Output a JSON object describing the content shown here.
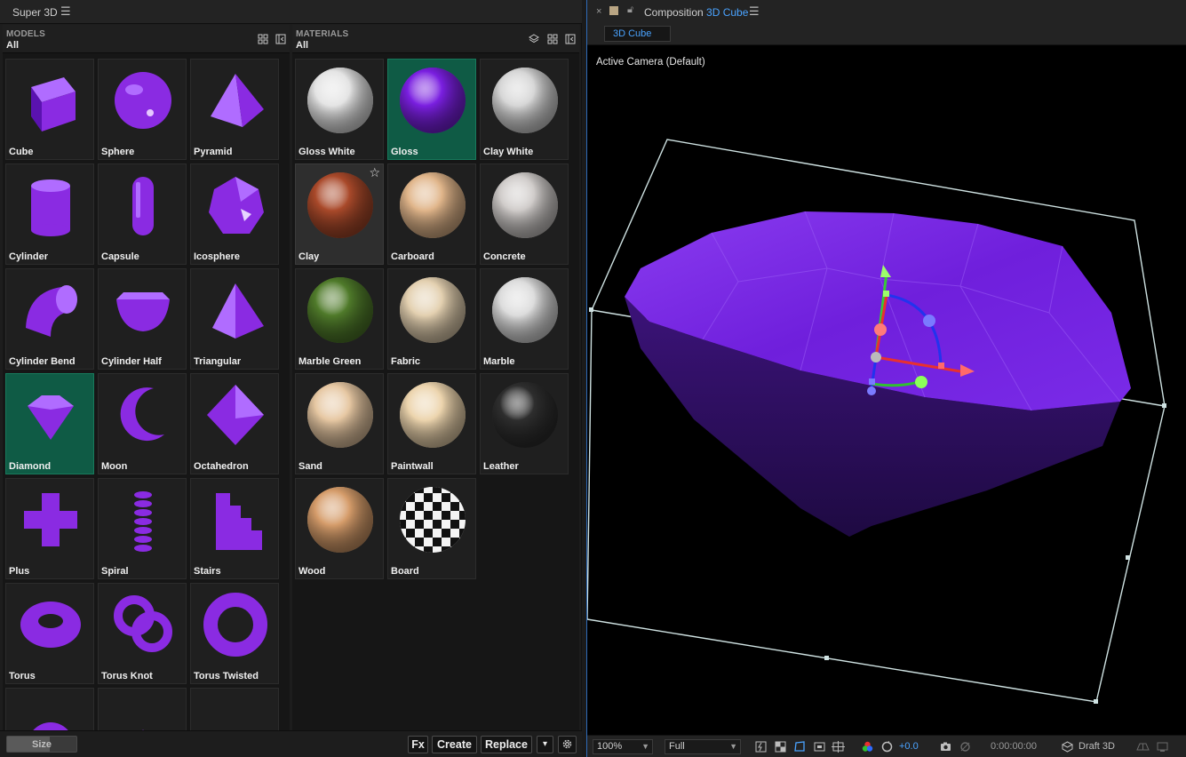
{
  "panel": {
    "title": "Super 3D",
    "menu_icon": "hamburger-icon"
  },
  "models": {
    "header_label": "MODELS",
    "header_sub": "All",
    "items": [
      {
        "label": "Cube",
        "shape": "cube"
      },
      {
        "label": "Sphere",
        "shape": "sphere"
      },
      {
        "label": "Pyramid",
        "shape": "pyramid"
      },
      {
        "label": "Cylinder",
        "shape": "cylinder"
      },
      {
        "label": "Capsule",
        "shape": "capsule"
      },
      {
        "label": "Icosphere",
        "shape": "icosphere"
      },
      {
        "label": "Cylinder Bend",
        "shape": "bend"
      },
      {
        "label": "Cylinder Half",
        "shape": "half"
      },
      {
        "label": "Triangular",
        "shape": "triangular"
      },
      {
        "label": "Diamond",
        "shape": "diamond",
        "selected": true
      },
      {
        "label": "Moon",
        "shape": "moon"
      },
      {
        "label": "Octahedron",
        "shape": "octahedron"
      },
      {
        "label": "Plus",
        "shape": "plus"
      },
      {
        "label": "Spiral",
        "shape": "spiral"
      },
      {
        "label": "Stairs",
        "shape": "stairs"
      },
      {
        "label": "Torus",
        "shape": "torus"
      },
      {
        "label": "Torus Knot",
        "shape": "knot"
      },
      {
        "label": "Torus Twisted",
        "shape": "twisted"
      },
      {
        "label": "",
        "shape": "gear"
      },
      {
        "label": "",
        "shape": "pyramid-small"
      },
      {
        "label": "",
        "shape": "star"
      }
    ]
  },
  "materials": {
    "header_label": "MATERIALS",
    "header_sub": "All",
    "items": [
      {
        "label": "Gloss White",
        "color": "#e4e4e4"
      },
      {
        "label": "Gloss",
        "color": "#7a1fe0",
        "selected": true
      },
      {
        "label": "Clay White",
        "color": "#d6d6d6"
      },
      {
        "label": "Clay",
        "color": "#a9492a",
        "hovered": true,
        "star": "☆"
      },
      {
        "label": "Carboard",
        "color": "#e0b58a"
      },
      {
        "label": "Concrete",
        "color": "#cfcbc9"
      },
      {
        "label": "Marble Green",
        "color": "#4f7a2a"
      },
      {
        "label": "Fabric",
        "color": "#e3d0b0"
      },
      {
        "label": "Marble",
        "color": "#dcdcdc"
      },
      {
        "label": "Sand",
        "color": "#e6c7a2"
      },
      {
        "label": "Paintwall",
        "color": "#ecd4ad"
      },
      {
        "label": "Leather",
        "color": "#2e2e2e"
      },
      {
        "label": "Wood",
        "color": "#d59c6a"
      },
      {
        "label": "Board",
        "color": "#ffffff",
        "checker": true
      }
    ]
  },
  "bottom_bar": {
    "size_label": "Size",
    "size_value": 0.62,
    "fx_label": "Fx",
    "create_label": "Create",
    "replace_label": "Replace",
    "dropdown_glyph": "▾",
    "settings_icon": "gear-icon"
  },
  "composition": {
    "close_glyph": "×",
    "title_prefix": "Composition",
    "name": "3D Cube",
    "tab_label": "3D Cube",
    "camera_label": "Active Camera (Default)",
    "gem_color": "#7a22e6"
  },
  "view_bar": {
    "zoom": "100%",
    "resolution": "Full",
    "exposure": "+0.0",
    "timecode": "0:00:00:00",
    "renderer": "Draft 3D"
  }
}
